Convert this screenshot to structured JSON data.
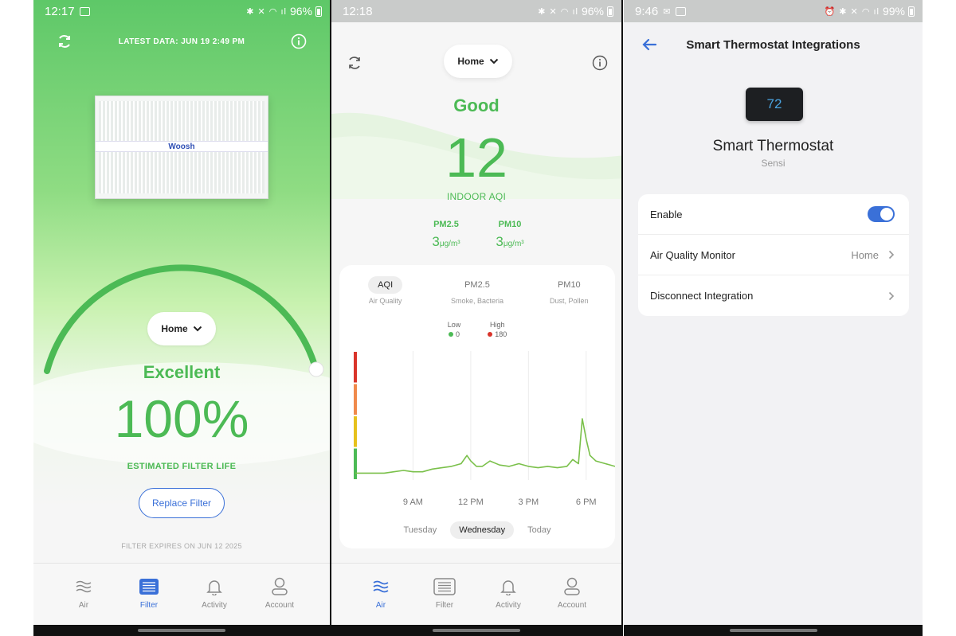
{
  "screens": {
    "filter": {
      "status_time": "12:17",
      "battery": "96%",
      "latest_data": "LATEST DATA: JUN 19 2:49 PM",
      "filter_brand": "Woosh",
      "location_selector": "Home",
      "status_word": "Excellent",
      "filter_life": "100%",
      "filter_life_label": "ESTIMATED FILTER LIFE",
      "filter_life_fraction": 1.0,
      "replace_button": "Replace Filter",
      "expires": "FILTER EXPIRES ON JUN 12 2025"
    },
    "air": {
      "status_time": "12:18",
      "battery": "96%",
      "location_selector": "Home",
      "status_word": "Good",
      "aqi_value": "12",
      "aqi_label": "INDOOR AQI",
      "pm25_label": "PM2.5",
      "pm25_value": "3",
      "pm10_label": "PM10",
      "pm10_value": "3",
      "unit": "μg/m³",
      "tabs": [
        {
          "label": "AQI",
          "sub": "Air Quality"
        },
        {
          "label": "PM2.5",
          "sub": "Smoke, Bacteria"
        },
        {
          "label": "PM10",
          "sub": "Dust, Pollen"
        }
      ],
      "legend": {
        "low_label": "Low",
        "low_value": "0",
        "high_label": "High",
        "high_value": "180"
      },
      "day_tabs": [
        "Tuesday",
        "Wednesday",
        "Today"
      ]
    },
    "thermostat": {
      "status_time": "9:46",
      "battery": "99%",
      "title": "Smart Thermostat Integrations",
      "device_display": "72",
      "device_name": "Smart Thermostat",
      "device_brand": "Sensi",
      "rows": {
        "enable": "Enable",
        "aqm_label": "Air Quality Monitor",
        "aqm_value": "Home",
        "disconnect": "Disconnect Integration"
      },
      "enabled": true
    }
  },
  "nav": [
    {
      "label": "Air",
      "icon": "waves-icon"
    },
    {
      "label": "Filter",
      "icon": "filter-icon"
    },
    {
      "label": "Activity",
      "icon": "bell-icon"
    },
    {
      "label": "Account",
      "icon": "user-icon"
    }
  ],
  "chart_data": {
    "type": "line",
    "title": "",
    "x_tick_labels": [
      "9 AM",
      "12 PM",
      "3 PM",
      "6 PM"
    ],
    "xlabel": "",
    "ylabel": "",
    "ylim": [
      0,
      180
    ],
    "grid": "vertical",
    "series": [
      {
        "x_hours": [
          6.0,
          6.5,
          7.0,
          7.5,
          8.0,
          8.5,
          9.0,
          9.5,
          10.0,
          10.5,
          11.0,
          11.5,
          11.8,
          12.0,
          12.3,
          12.6,
          13.0,
          13.5,
          14.0,
          14.5,
          15.0,
          15.5,
          16.0,
          16.5,
          17.0,
          17.3,
          17.6,
          17.8,
          18.0,
          18.2,
          18.5,
          19.0,
          19.5
        ],
        "values": [
          5,
          5,
          5,
          5,
          6,
          7,
          6,
          6,
          8,
          9,
          10,
          12,
          18,
          14,
          10,
          10,
          14,
          11,
          10,
          12,
          10,
          9,
          10,
          9,
          10,
          15,
          12,
          45,
          30,
          18,
          14,
          12,
          10
        ]
      }
    ],
    "legend": "top-center"
  }
}
